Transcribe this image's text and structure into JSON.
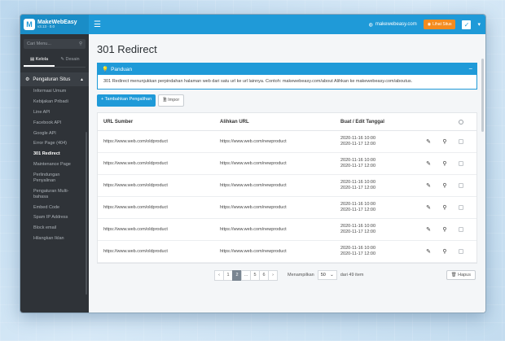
{
  "brand": {
    "name": "MakeWebEasy",
    "version": "v3.13 ∙ 0.0"
  },
  "topbar": {
    "site": "makewebeasy.com",
    "view_button": "Lihat Situs"
  },
  "sidebar": {
    "search_placeholder": "Cari Menu...",
    "tabs": [
      {
        "label": "Kelola"
      },
      {
        "label": "Desain"
      }
    ],
    "group": "Pengaturan Situs",
    "items": [
      {
        "label": "Informasi Umum"
      },
      {
        "label": "Kebijakan Pribadi"
      },
      {
        "label": "Line API"
      },
      {
        "label": "Facebook API"
      },
      {
        "label": "Google API"
      },
      {
        "label": "Error Page (404)"
      },
      {
        "label": "301 Redirect"
      },
      {
        "label": "Maintenance Page"
      },
      {
        "label": "Perlindungan Penyalinan"
      },
      {
        "label": "Pengaturan Multi-bahasa"
      },
      {
        "label": "Embed Code"
      },
      {
        "label": "Spam IP Address"
      },
      {
        "label": "Block email"
      },
      {
        "label": "Hilangkan Iklan"
      }
    ]
  },
  "main": {
    "title": "301 Redirect",
    "guide": {
      "title": "Panduan",
      "text": "301 Redirect menunjukkan perpindahan halaman web dari satu url ke url lainnya. Contoh: makewebeasy.com/about Alihkan ke makewebeasy.com/aboutus."
    },
    "add_button": "+ Tambahkan Pengalihan",
    "import_button": "Impor",
    "table": {
      "headers": {
        "source": "URL Sumber",
        "target": "Alihkan URL",
        "date": "Buat / Edit Tanggal"
      },
      "rows": [
        {
          "source": "https://www.web.com/oldproduct",
          "target": "https://www.web.com/newproduct",
          "created": "2020-11-16  10:00",
          "edited": "2020-11-17  12:00"
        },
        {
          "source": "https://www.web.com/oldproduct",
          "target": "https://www.web.com/newproduct",
          "created": "2020-11-16  10:00",
          "edited": "2020-11-17  12:00"
        },
        {
          "source": "https://www.web.com/oldproduct",
          "target": "https://www.web.com/newproduct",
          "created": "2020-11-16  10:00",
          "edited": "2020-11-17  12:00"
        },
        {
          "source": "https://www.web.com/oldproduct",
          "target": "https://www.web.com/newproduct",
          "created": "2020-11-16  10:00",
          "edited": "2020-11-17  12:00"
        },
        {
          "source": "https://www.web.com/oldproduct",
          "target": "https://www.web.com/newproduct",
          "created": "2020-11-16  10:00",
          "edited": "2020-11-17  12:00"
        },
        {
          "source": "https://www.web.com/oldproduct",
          "target": "https://www.web.com/newproduct",
          "created": "2020-11-16  10:00",
          "edited": "2020-11-17  12:00"
        }
      ]
    },
    "pagination": {
      "pages": [
        "‹",
        "1",
        "2",
        "...",
        "5",
        "6",
        "›"
      ],
      "active": "2",
      "show_label": "Menampilkan",
      "per_page": "50",
      "total": "dari 49 item",
      "delete_button": "Hapus"
    }
  },
  "colors": {
    "primary": "#1f9ad8",
    "orange": "#f38b1e",
    "sidebar": "#2f3338"
  }
}
